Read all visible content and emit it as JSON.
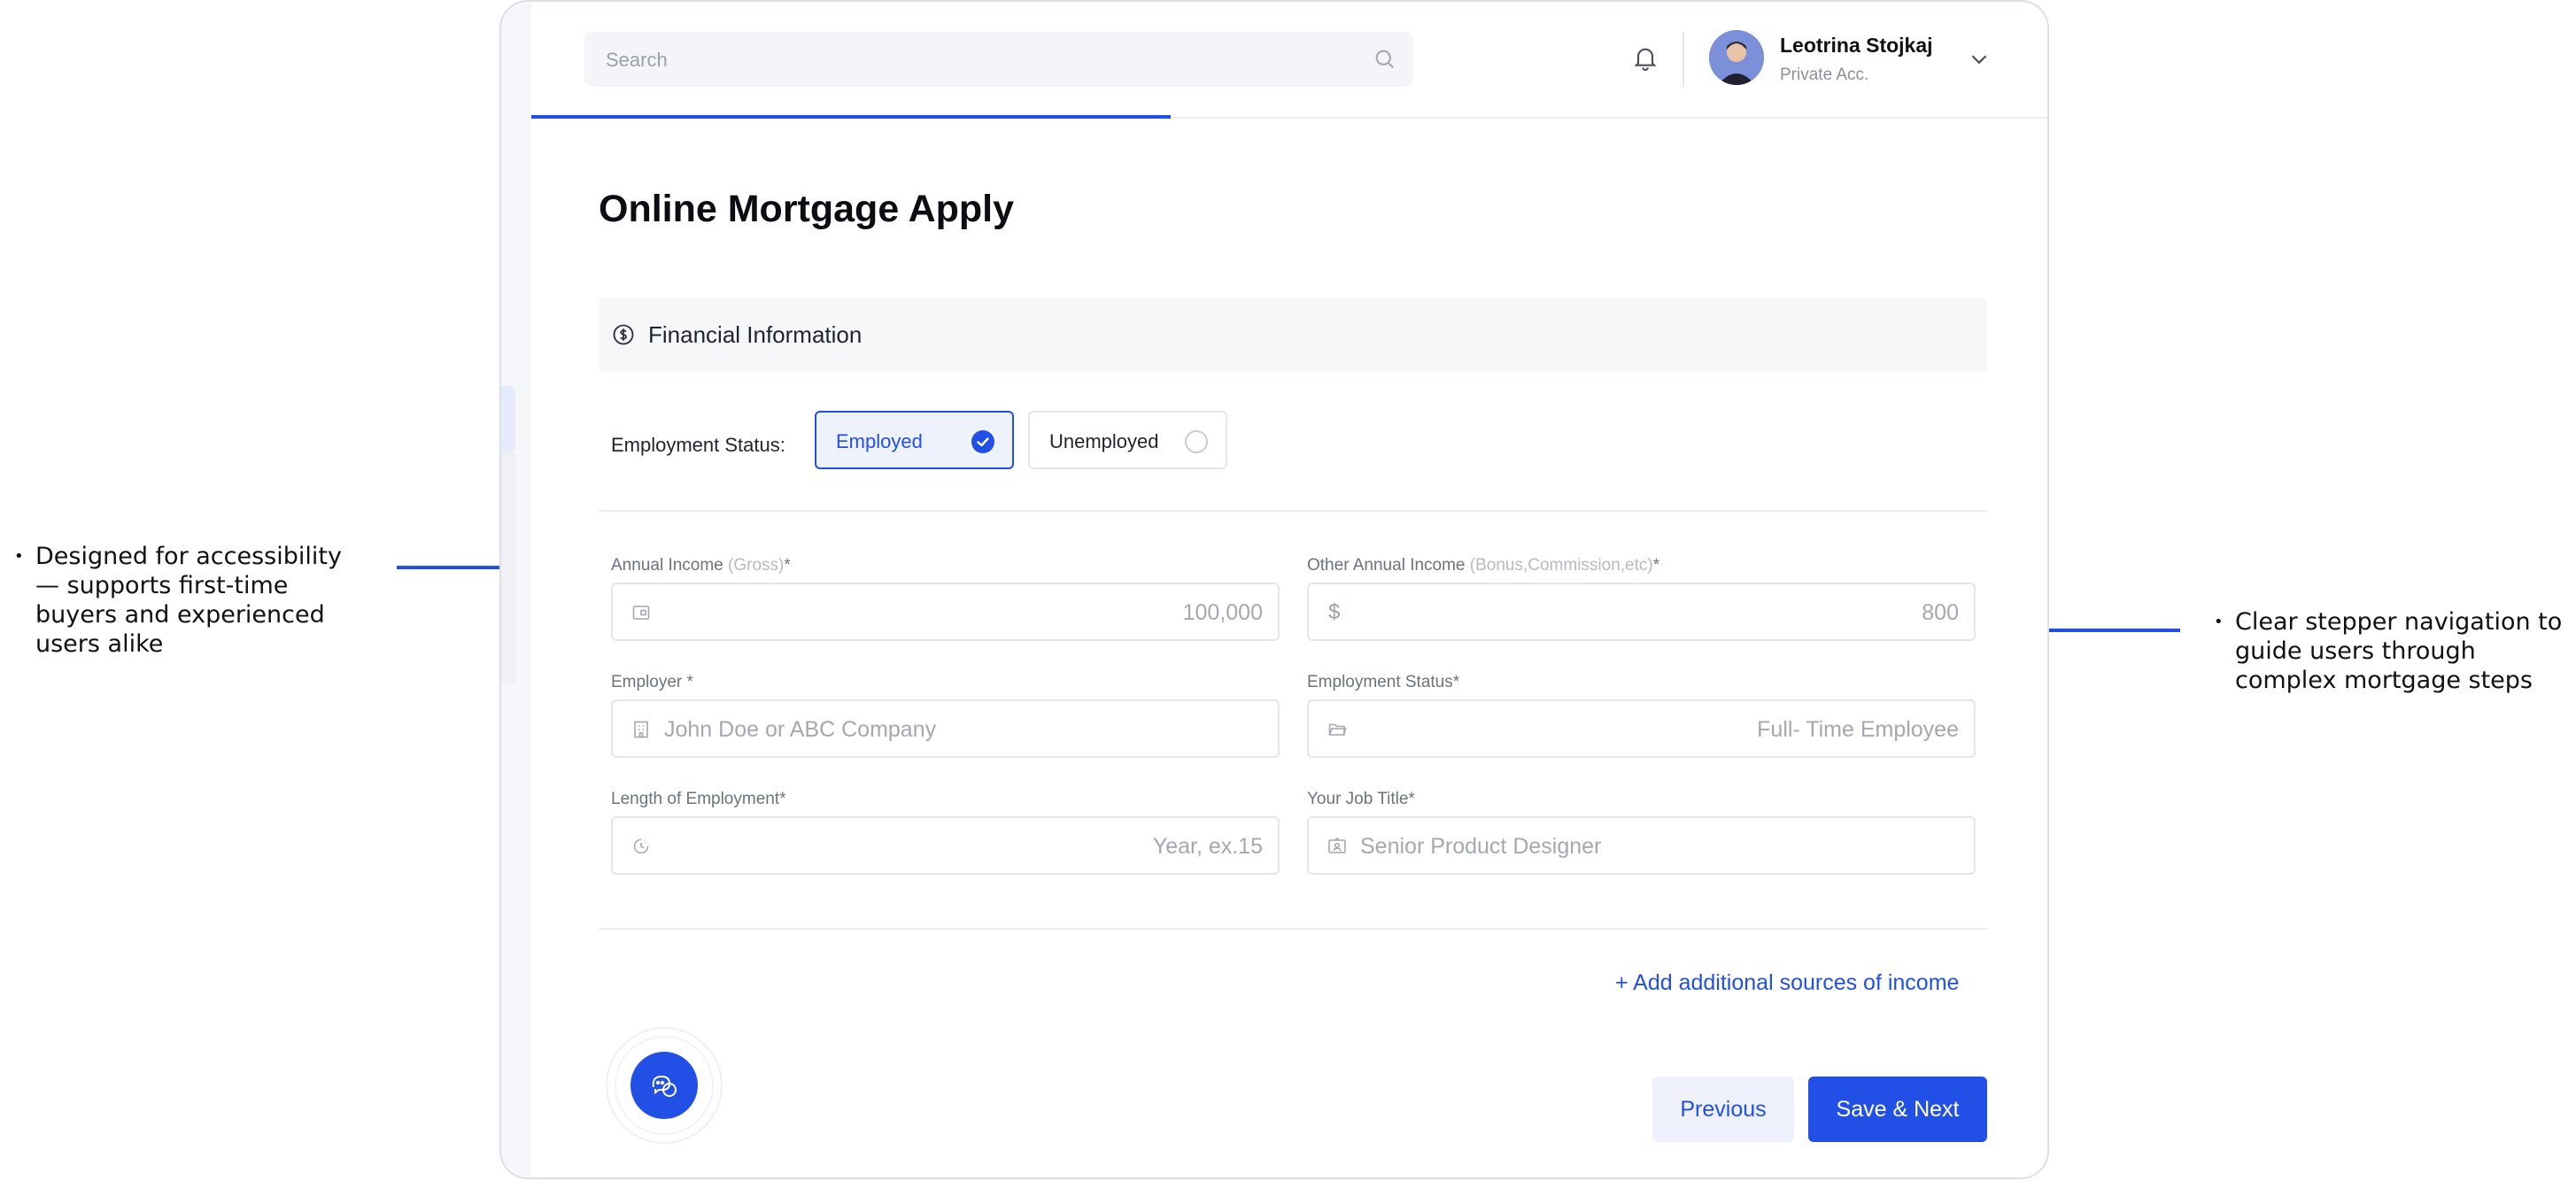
{
  "annotations": {
    "left": "Designed for accessibility — supports first-time buyers and experienced users alike",
    "right": "Clear stepper navigation to guide users through complex mortgage steps"
  },
  "header": {
    "search_placeholder": "Search",
    "user_name": "Leotrina Stojkaj",
    "account_type": "Private Acc."
  },
  "page": {
    "title": "Online Mortgage Apply",
    "section_title": "Financial Information"
  },
  "employment_status": {
    "label": "Employment Status:",
    "options": [
      {
        "label": "Employed",
        "selected": true
      },
      {
        "label": "Unemployed",
        "selected": false
      }
    ]
  },
  "fields": {
    "annual_income": {
      "label": "Annual Income",
      "hint": "(Gross)",
      "required": "*",
      "placeholder": "100,000"
    },
    "other_income": {
      "label": "Other Annual Income",
      "hint": "(Bonus,Commission,etc)",
      "required": "*",
      "currency": "$",
      "placeholder": "800"
    },
    "employer": {
      "label": "Employer *",
      "placeholder": "John Doe or ABC Company"
    },
    "employment_status": {
      "label": "Employment Status*",
      "placeholder": "Full- Time Employee"
    },
    "length_of_employment": {
      "label": "Length of Employment*",
      "placeholder": "Year, ex.15"
    },
    "job_title": {
      "label": "Your Job Title*",
      "placeholder": "Senior Product Designer"
    }
  },
  "actions": {
    "add_income": "+ Add additional sources of income",
    "previous": "Previous",
    "save_next": "Save & Next"
  },
  "colors": {
    "accent": "#2250e6",
    "border": "#e4e6eb",
    "section_bg": "#f6f7f9"
  },
  "icons": [
    "search-icon",
    "bell-icon",
    "chevron-down-icon",
    "dollar-circle-icon",
    "check-icon",
    "wallet-icon",
    "building-icon",
    "folder-icon",
    "clock-icon",
    "id-card-icon",
    "chat-icon"
  ]
}
